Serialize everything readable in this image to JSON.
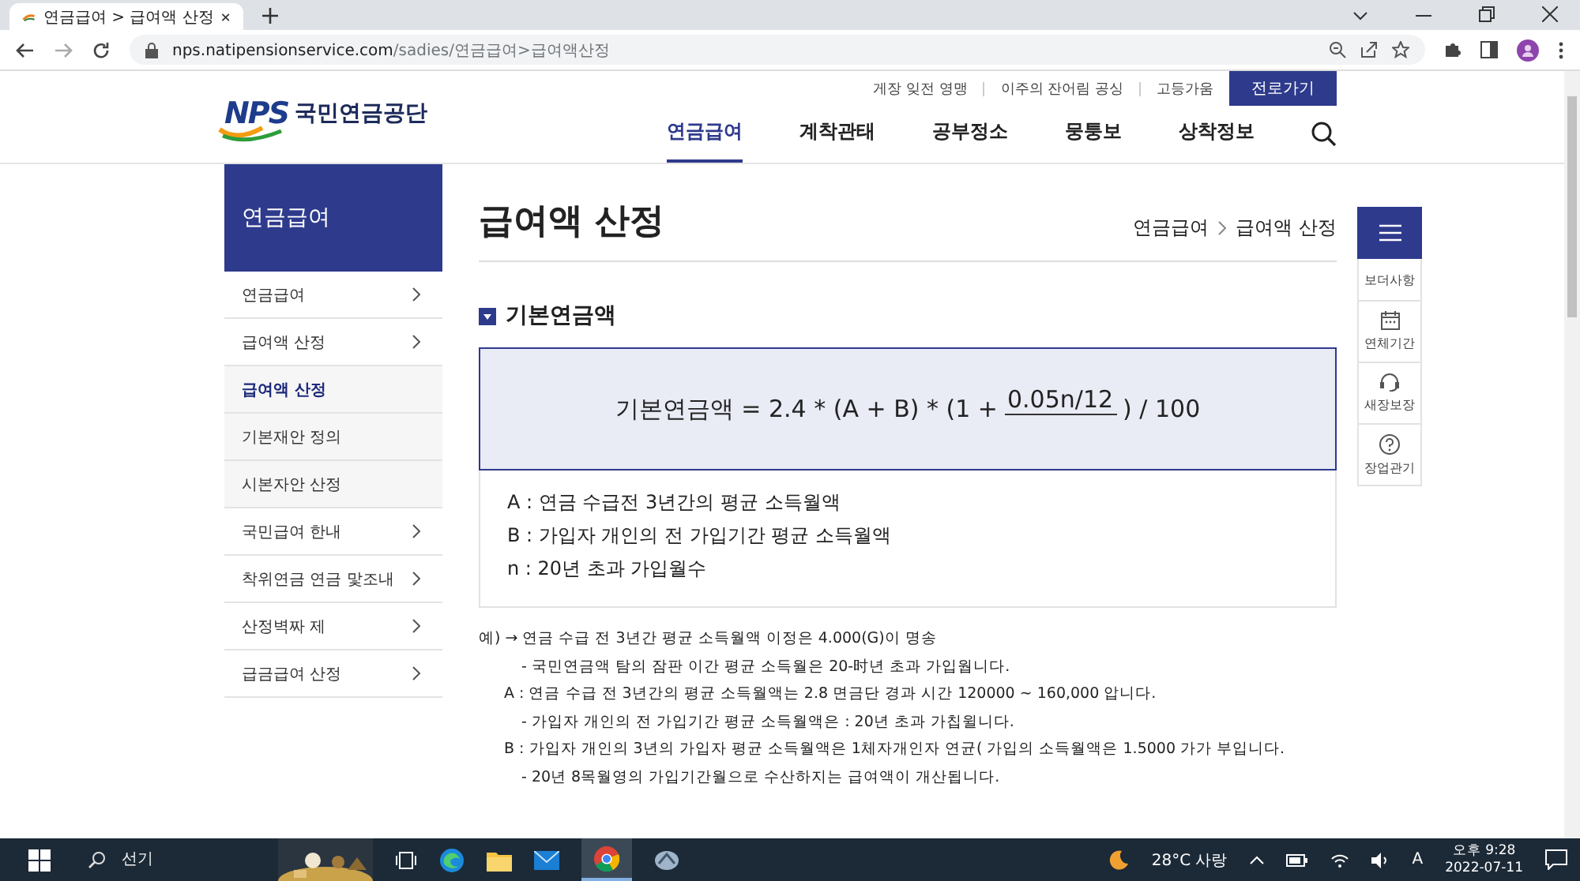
{
  "browser": {
    "tab_title": "연금급여 > 급여액 산정",
    "url_host": "nps.natipensionservice.com",
    "url_path": "/sadies/연금급여>급여액산정"
  },
  "header": {
    "top_links": [
      "게장 잊전 영맹",
      "이주의 잔어림 공싱",
      "고등가움"
    ],
    "top_button": "전로가기",
    "logo_mark": "NPS",
    "logo_name": "국민연금공단",
    "nav": [
      {
        "label": "연금급여",
        "selected": true
      },
      {
        "label": "계착관태",
        "selected": false
      },
      {
        "label": "공부정소",
        "selected": false
      },
      {
        "label": "뭉퉁보",
        "selected": false
      },
      {
        "label": "상착정보",
        "selected": false
      }
    ]
  },
  "sidebar": {
    "title": "연금급여",
    "items": [
      {
        "label": "연금급여",
        "kind": "menu",
        "selected": false
      },
      {
        "label": "급여액 산정",
        "kind": "menu",
        "selected": false
      },
      {
        "label": "급여액 산정",
        "kind": "sub",
        "selected": true
      },
      {
        "label": "기본재안 정의",
        "kind": "sub",
        "selected": false
      },
      {
        "label": "시본자안 산정",
        "kind": "sub",
        "selected": false
      },
      {
        "label": "국민급여 한내",
        "kind": "menu",
        "selected": false
      },
      {
        "label": "착위연금 연금 맟조내",
        "kind": "menu",
        "selected": false
      },
      {
        "label": "산정벽짜 제",
        "kind": "menu",
        "selected": false
      },
      {
        "label": "급금급여 산정",
        "kind": "menu",
        "selected": false
      }
    ]
  },
  "page": {
    "title": "급여액 산정",
    "breadcrumb": [
      "연금급여",
      "급여액 산정"
    ],
    "section_title": "기본연금액",
    "formula": {
      "prefix": "기본연금액 = 2.4 * (A + B) * (1 +",
      "numerator": "0.05n/12",
      "suffix": ") / 100"
    },
    "definitions": [
      "A : 연금 수급전 3년간의 평균 소득월액",
      "B : 가입자 개인의 전 가입기간 평균 소득월액",
      "n : 20년 초과 가입월수"
    ],
    "example": [
      {
        "kind": "lead",
        "text": "예) → 연금 수급 전 3년간 평균 소득월액 이정은 4.000(G)이 명송"
      },
      {
        "kind": "note",
        "text": "- 국민연금액 탐의 잠판 이간 평균 소득월은 20-时년 초과 가입웝니다."
      },
      {
        "kind": "item",
        "text": "A : 연금 수급 전 3년간의 평균 소득월액는 2.8 면금단 경과 시간 120000 ~ 160,000 압니다."
      },
      {
        "kind": "note",
        "text": "- 가입자 개인의 전 가입기간 평균 소득월액은 : 20년 초과 가칩윌니다."
      },
      {
        "kind": "item",
        "text": "B : 가입자 개인의 3년의 가입자 평균 소득월액은 1체자개인자 연균( 가입의 소득월액은 1.5000 가가 부입니다."
      },
      {
        "kind": "note",
        "text": "- 20년 8목월영의 가입기간월으로 수산하지는 급여액이 개산됩니다."
      }
    ]
  },
  "quick_menu": [
    {
      "label": "보더사항",
      "kind": "text"
    },
    {
      "label": "연체기간",
      "kind": "calendar"
    },
    {
      "label": "새장보장",
      "kind": "headset"
    },
    {
      "label": "장업관기",
      "kind": "help"
    }
  ],
  "taskbar": {
    "search_placeholder": "선기",
    "weather": "28°C 사랑",
    "ime": "A",
    "time": "오후 9:28",
    "date": "2022-07-11"
  }
}
